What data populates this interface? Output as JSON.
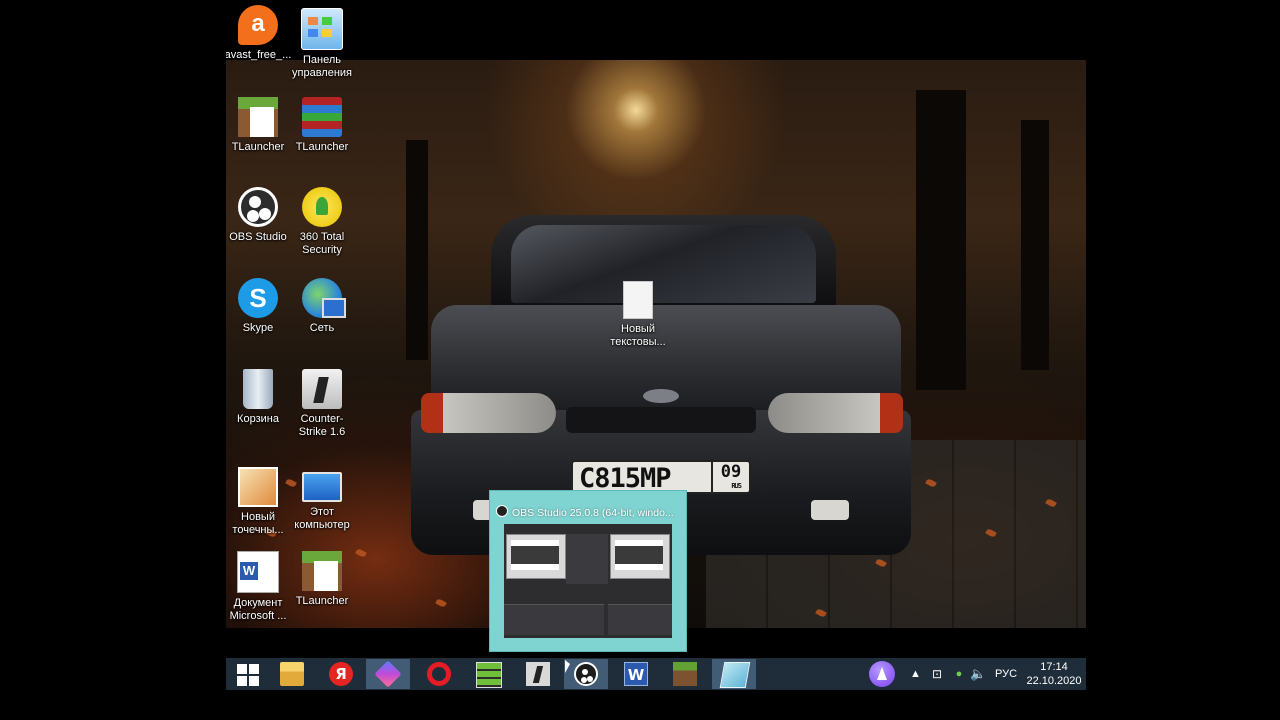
{
  "desktop": {
    "icons": [
      {
        "label": "avast_free_...",
        "icon": "avast-icon"
      },
      {
        "label": "Панель управления",
        "icon": "control-panel-icon"
      },
      {
        "label": "TLauncher",
        "icon": "tlauncher-icon"
      },
      {
        "label": "TLauncher",
        "icon": "winrar-icon"
      },
      {
        "label": "OBS Studio",
        "icon": "obs-icon"
      },
      {
        "label": "360 Total Security",
        "icon": "360-security-icon"
      },
      {
        "label": "Skype",
        "icon": "skype-icon"
      },
      {
        "label": "Сеть",
        "icon": "network-icon"
      },
      {
        "label": "Корзина",
        "icon": "recycle-bin-icon"
      },
      {
        "label": "Counter-Strike 1.6",
        "icon": "counter-strike-icon"
      },
      {
        "label": "Новый точечны...",
        "icon": "bitmap-image-icon"
      },
      {
        "label": "Этот компьютер",
        "icon": "this-pc-icon"
      },
      {
        "label": "Документ Microsoft ...",
        "icon": "word-document-icon"
      },
      {
        "label": "TLauncher",
        "icon": "tlauncher-icon"
      },
      {
        "label": "Новый текстовы...",
        "icon": "text-document-icon"
      }
    ],
    "wallpaper": {
      "plate_number": "С815МР",
      "plate_region": "09",
      "plate_country": "RUS"
    }
  },
  "preview": {
    "title": "OBS Studio 25.0.8 (64-bit, windo..."
  },
  "taskbar": {
    "apps": [
      {
        "name": "start-button",
        "icon": "windows-icon"
      },
      {
        "name": "file-explorer",
        "icon": "folder-icon"
      },
      {
        "name": "yandex-browser",
        "icon": "yandex-icon",
        "glyph": "Я"
      },
      {
        "name": "app-gem",
        "icon": "gem-icon"
      },
      {
        "name": "opera",
        "icon": "opera-icon"
      },
      {
        "name": "winrar",
        "icon": "winrar-icon"
      },
      {
        "name": "counter-strike",
        "icon": "counter-strike-icon"
      },
      {
        "name": "obs-studio",
        "icon": "obs-icon",
        "active": true
      },
      {
        "name": "word",
        "icon": "word-icon",
        "glyph": "W"
      },
      {
        "name": "minecraft",
        "icon": "minecraft-icon"
      },
      {
        "name": "glass-app",
        "icon": "glass-icon"
      }
    ],
    "tray": {
      "language": "РУС",
      "time": "17:14",
      "date": "22.10.2020"
    }
  },
  "colors": {
    "taskbar_bg": "#202e3c",
    "preview_bg": "#7fd3d0",
    "active_highlight": "#6e96be"
  }
}
